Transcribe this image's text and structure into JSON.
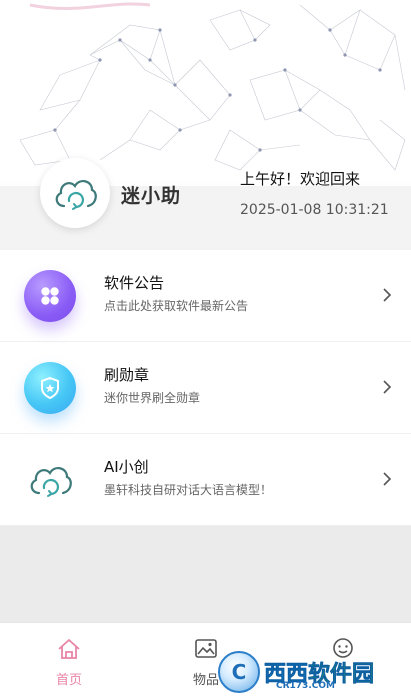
{
  "header": {
    "app_name": "迷小助",
    "greeting": "上午好！欢迎回来",
    "datetime": "2025-01-08 10:31:21",
    "avatar_icon": "cloud-refresh-icon"
  },
  "menu": {
    "items": [
      {
        "title": "软件公告",
        "subtitle": "点击此处获取软件最新公告",
        "icon": "clover-icon",
        "accent": "#8a5cf6"
      },
      {
        "title": "刷勋章",
        "subtitle": "迷你世界刷全勋章",
        "icon": "shield-star-icon",
        "accent": "#45c6f5"
      },
      {
        "title": "AI小创",
        "subtitle": "墨轩科技自研对话大语言模型！",
        "icon": "cloud-refresh-icon",
        "accent": "#2a8a8a"
      }
    ]
  },
  "tabbar": {
    "tabs": [
      {
        "label": "首页",
        "icon": "home-icon",
        "active": true
      },
      {
        "label": "物品",
        "icon": "image-icon",
        "active": false
      },
      {
        "label": "",
        "icon": "smiley-icon",
        "active": false
      }
    ],
    "active_color": "#e884a7"
  },
  "watermark": {
    "text_blue": "西西",
    "text_green": "软件园",
    "url": "CR173.COM",
    "logo_letter": "C"
  }
}
